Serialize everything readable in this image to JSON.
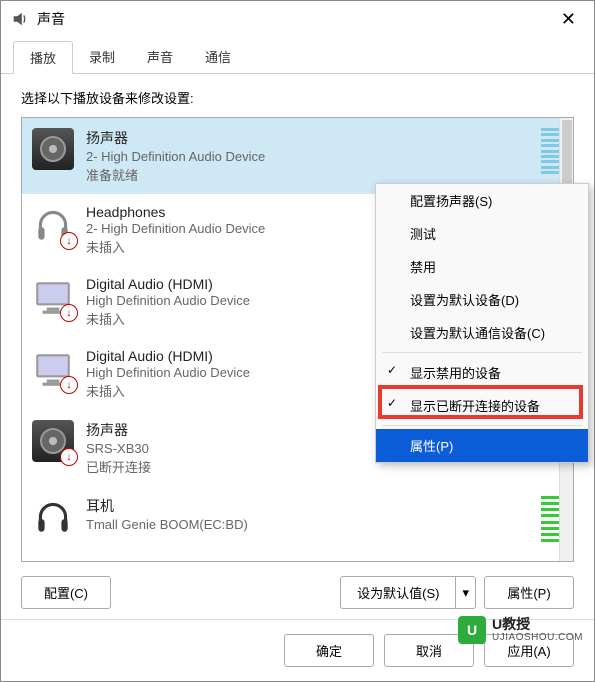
{
  "window": {
    "title": "声音"
  },
  "tabs": {
    "play": "播放",
    "record": "录制",
    "sounds": "声音",
    "comm": "通信"
  },
  "instruction": "选择以下播放设备来修改设置:",
  "devices": [
    {
      "name": "扬声器",
      "sub": "2- High Definition Audio Device",
      "status": "准备就绪",
      "selected": true,
      "icon": "speaker",
      "meter": "blue"
    },
    {
      "name": "Headphones",
      "sub": "2- High Definition Audio Device",
      "status": "未插入",
      "icon": "headphone",
      "badge": true
    },
    {
      "name": "Digital Audio (HDMI)",
      "sub": "High Definition Audio Device",
      "status": "未插入",
      "icon": "monitor",
      "badge": true
    },
    {
      "name": "Digital Audio (HDMI)",
      "sub": "High Definition Audio Device",
      "status": "未插入",
      "icon": "monitor",
      "badge": true
    },
    {
      "name": "扬声器",
      "sub": "SRS-XB30",
      "status": "已断开连接",
      "icon": "speaker",
      "badge": true
    },
    {
      "name": "耳机",
      "sub": "Tmall Genie BOOM(EC:BD)",
      "status": "",
      "icon": "headphone",
      "meter": "green"
    }
  ],
  "contextMenu": {
    "configure": "配置扬声器(S)",
    "test": "测试",
    "disable": "禁用",
    "setDefault": "设置为默认设备(D)",
    "setComm": "设置为默认通信设备(C)",
    "showDisabled": "显示禁用的设备",
    "showDisconnected": "显示已断开连接的设备",
    "properties": "属性(P)"
  },
  "buttons": {
    "configure": "配置(C)",
    "setDefaultVal": "设为默认值(S)",
    "properties": "属性(P)",
    "ok": "确定",
    "cancel": "取消",
    "apply": "应用(A)"
  },
  "watermark": {
    "name": "U教授",
    "url": "UJIAOSHOU.COM",
    "logo": "U"
  }
}
